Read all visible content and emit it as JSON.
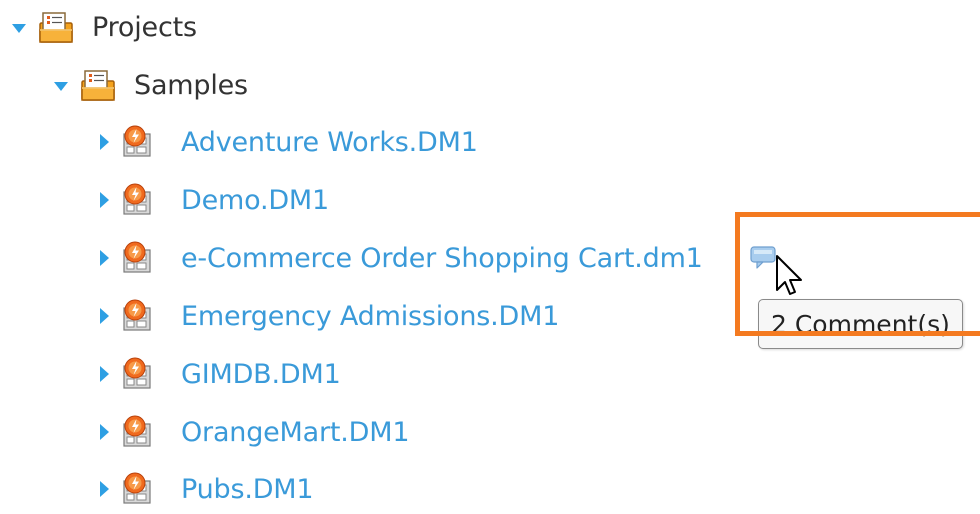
{
  "tree": {
    "root": {
      "label": "Projects",
      "icon": "project-folder-icon",
      "expanded": true
    },
    "folder": {
      "label": "Samples",
      "icon": "project-folder-icon",
      "expanded": true
    },
    "items": [
      {
        "label": "Adventure Works.DM1",
        "icon": "data-model-icon"
      },
      {
        "label": "Demo.DM1",
        "icon": "data-model-icon"
      },
      {
        "label": "e-Commerce Order Shopping Cart.dm1",
        "icon": "data-model-icon",
        "has_comments": true
      },
      {
        "label": "Emergency Admissions.DM1",
        "icon": "data-model-icon"
      },
      {
        "label": "GIMDB.DM1",
        "icon": "data-model-icon"
      },
      {
        "label": "OrangeMart.DM1",
        "icon": "data-model-icon"
      },
      {
        "label": "Pubs.DM1",
        "icon": "data-model-icon"
      }
    ]
  },
  "tooltip": {
    "text": "2 Comment(s)"
  },
  "colors": {
    "link": "#3a9ad9",
    "arrow": "#2e9fe3",
    "highlight": "#f47a20",
    "text": "#333333"
  }
}
